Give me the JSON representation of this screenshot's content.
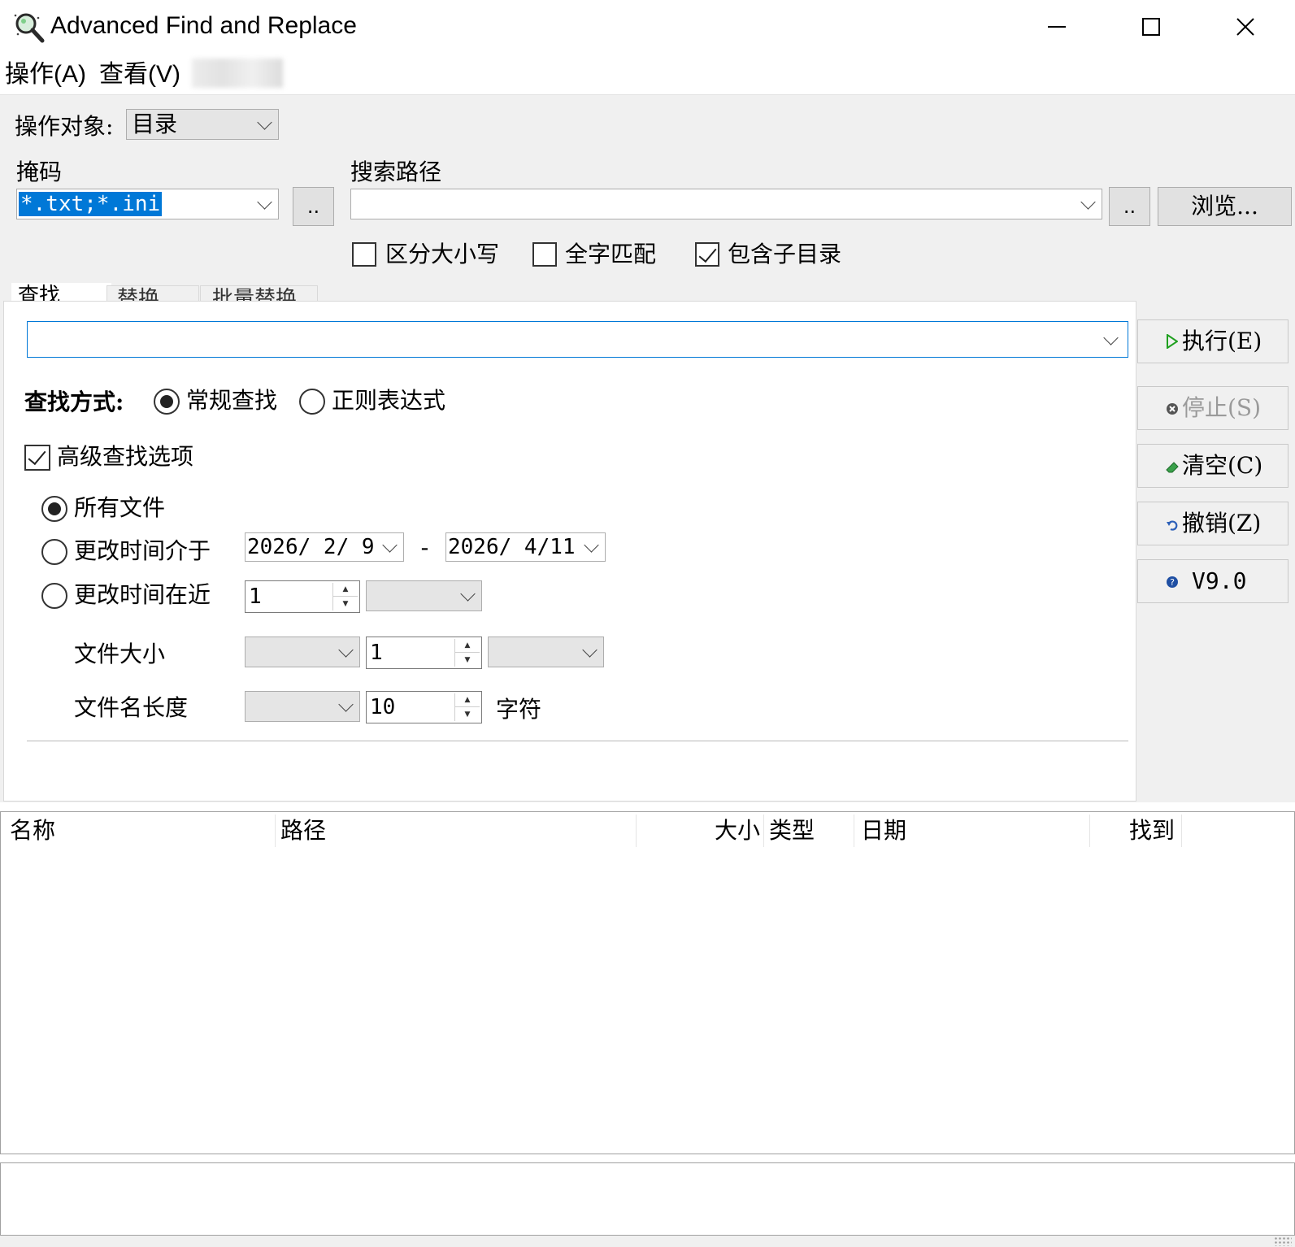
{
  "window": {
    "title": "Advanced Find and Replace",
    "icon": "magnifier-app-icon",
    "controls": {
      "minimize": "minimize-icon",
      "maximize": "maximize-icon",
      "close": "close-icon"
    }
  },
  "menubar": {
    "items": [
      "操作(A)",
      "查看(V)"
    ]
  },
  "top": {
    "target_label": "操作对象:",
    "target_value": "目录",
    "mask_label": "掩码",
    "mask_value": "*.txt;*.ini",
    "mask_more": "..",
    "path_label": "搜索路径",
    "path_value": "",
    "path_more": "..",
    "browse": "浏览...",
    "match_case": {
      "label": "区分大小写",
      "checked": false
    },
    "whole_word": {
      "label": "全字匹配",
      "checked": false
    },
    "subdirs": {
      "label": "包含子目录",
      "checked": true
    }
  },
  "tabs": [
    "查找",
    "替换",
    "批量替换"
  ],
  "find": {
    "query": "",
    "mode_label": "查找方式:",
    "mode_normal": "常规查找",
    "mode_regex": "正则表达式",
    "advanced_label": "高级查找选项",
    "all_files": "所有文件",
    "date_between": "更改时间介于",
    "date_from": "2026/ 2/ 9",
    "date_to": "2026/ 4/11",
    "date_sep": "-",
    "recent": "更改时间在近",
    "recent_value": "1",
    "size_label": "文件大小",
    "size_value": "1",
    "name_len_label": "文件名长度",
    "name_len_value": "10",
    "chars_label": "字符"
  },
  "actions": {
    "execute": "执行(E)",
    "stop": "停止(S)",
    "clear": "清空(C)",
    "undo": "撤销(Z)",
    "version": "V9.0"
  },
  "results": {
    "columns": [
      "名称",
      "路径",
      "大小",
      "类型",
      "日期",
      "找到"
    ],
    "rows": []
  },
  "colors": {
    "selection": "#0078d7",
    "panel": "#f0f0f0",
    "focus_border": "#0078d7",
    "play": "#1fa01f",
    "clear": "#3aa04a",
    "undo": "#2b5fb8",
    "help": "#1f4fa3"
  }
}
